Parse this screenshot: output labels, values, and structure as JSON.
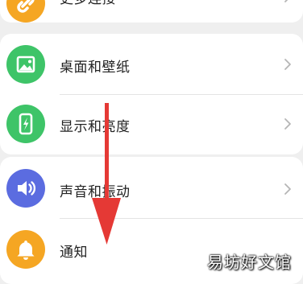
{
  "settings": {
    "items": [
      {
        "label": "更多连接",
        "icon": "link-icon",
        "color": "#f5a623"
      },
      {
        "label": "桌面和壁纸",
        "icon": "image-icon",
        "color": "#3ec468"
      },
      {
        "label": "显示和亮度",
        "icon": "phone-brightness-icon",
        "color": "#3ec468"
      },
      {
        "label": "声音和振动",
        "icon": "speaker-icon",
        "color": "#5b6ce0"
      },
      {
        "label": "通知",
        "icon": "bell-icon",
        "color": "#f5a623"
      }
    ]
  },
  "watermark": {
    "text": "易坊好文馆"
  },
  "annotation": {
    "color": "#e53935"
  }
}
